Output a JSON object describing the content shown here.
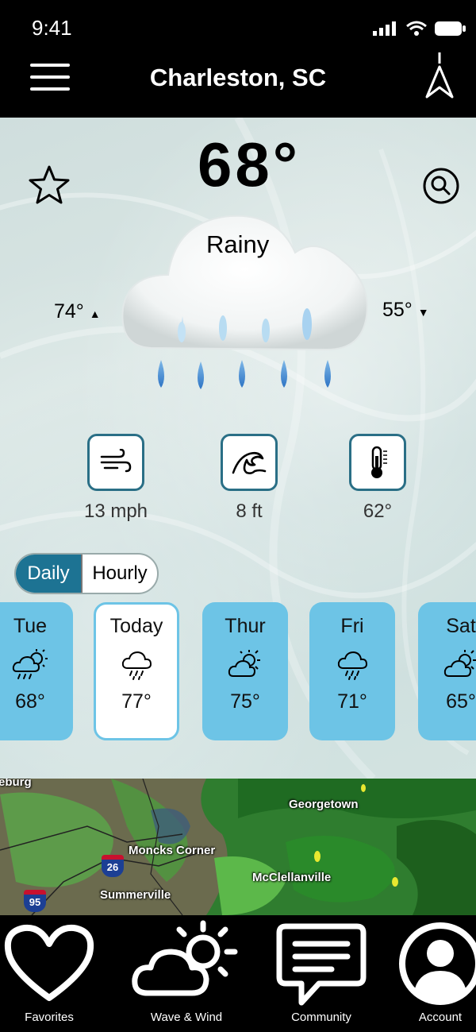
{
  "status_bar": {
    "time": "9:41"
  },
  "header": {
    "city": "Charleston, SC"
  },
  "current": {
    "temperature": "68°",
    "condition": "Rainy",
    "high": "74°",
    "high_arrow": "▲",
    "low": "55°",
    "low_arrow": "▼"
  },
  "stats": {
    "wind": "13 mph",
    "wave": "8 ft",
    "water_temp": "62°"
  },
  "toggle": {
    "daily": "Daily",
    "hourly": "Hourly"
  },
  "days": [
    {
      "name": "Tue",
      "temp": "68°",
      "icon": "sun-cloud-rain-icon"
    },
    {
      "name": "Today",
      "temp": "77°",
      "icon": "cloud-rain-icon"
    },
    {
      "name": "Thur",
      "temp": "75°",
      "icon": "partly-cloudy-icon"
    },
    {
      "name": "Fri",
      "temp": "71°",
      "icon": "cloud-rain-icon"
    },
    {
      "name": "Sat",
      "temp": "65°",
      "icon": "partly-cloudy-icon"
    }
  ],
  "map": {
    "labels": {
      "partial": "eburg",
      "georgetown": "Georgetown",
      "moncks_corner": "Moncks Corner",
      "mcclellanville": "McClellanville",
      "summerville": "Summerville"
    },
    "shields": {
      "i26": "26",
      "i95": "95"
    }
  },
  "tabs": {
    "favorites": "Favorites",
    "wave_wind": "Wave & Wind",
    "community": "Community",
    "account": "Account"
  },
  "colors": {
    "accent": "#1d7393",
    "card": "#6dc4e6",
    "icon_border": "#2a6f86",
    "rain_drop": "#4a8fd0"
  }
}
